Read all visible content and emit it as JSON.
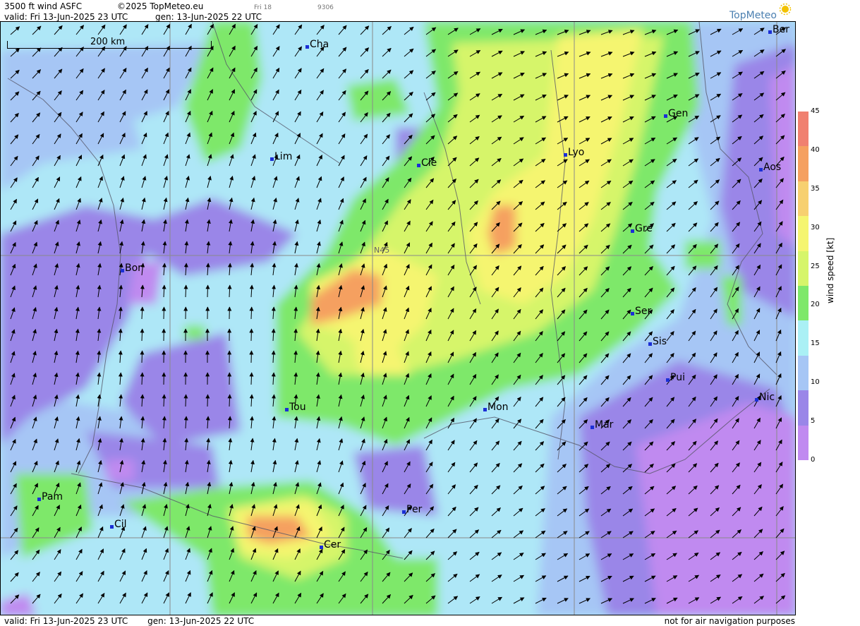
{
  "header": {
    "product": "3500 ft wind ASFC",
    "copyright": "©2025 TopMeteo.eu",
    "day_tab": "Fri 18",
    "code": "9306",
    "valid": "valid:  Fri  13-Jun-2025  23 UTC",
    "generated": "gen: 13-Jun-2025 22 UTC"
  },
  "footer": {
    "valid": "valid:  Fri  13-Jun-2025  23 UTC",
    "generated": "gen: 13-Jun-2025 22 UTC",
    "disclaimer": "not for air navigation purposes"
  },
  "logo": {
    "text": "TopMeteo"
  },
  "scale": {
    "label": "200 km"
  },
  "grid": {
    "lat_label": "N45"
  },
  "cities": [
    {
      "name": "Cha"
    },
    {
      "name": "Ber"
    },
    {
      "name": "Lim"
    },
    {
      "name": "Cle"
    },
    {
      "name": "Lyo"
    },
    {
      "name": "Gen"
    },
    {
      "name": "Aos"
    },
    {
      "name": "Gre"
    },
    {
      "name": "Bor"
    },
    {
      "name": "Ser"
    },
    {
      "name": "Sis"
    },
    {
      "name": "Pui"
    },
    {
      "name": "Tou"
    },
    {
      "name": "Mon"
    },
    {
      "name": "Mar"
    },
    {
      "name": "Nic"
    },
    {
      "name": "Pam"
    },
    {
      "name": "Cil"
    },
    {
      "name": "Per"
    },
    {
      "name": "Cer"
    }
  ],
  "legend": {
    "title": "wind  speed  [kt]",
    "ticks": [
      "45",
      "40",
      "35",
      "30",
      "25",
      "20",
      "15",
      "10",
      "5",
      "0"
    ],
    "colors": [
      "#f08070",
      "#f5a060",
      "#f7d070",
      "#f5f570",
      "#d6f56a",
      "#7ee86a",
      "#aaf0f5",
      "#a6c6f5",
      "#9a86e8",
      "#c08af0"
    ]
  }
}
